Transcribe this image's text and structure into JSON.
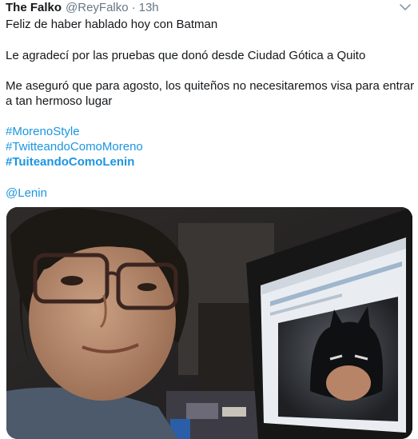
{
  "tweet": {
    "display_name": "The Falko",
    "handle": "@ReyFalko",
    "separator": "·",
    "time": "13h",
    "lines": {
      "l1": "Feliz de haber hablado hoy con Batman",
      "l2": "Le agradecí por las pruebas que donó desde Ciudad Gótica a Quito",
      "l3": "Me aseguró que para agosto, los quiteños no necesitaremos visa para entrar",
      "l4": "a tan hermoso lugar"
    },
    "hashtags": [
      "#MorenoStyle",
      "#TwitteandoComoMoreno",
      "#TuiteandoComoLenin"
    ],
    "mention": "@Lenin",
    "caret_icon": "chevron-down-icon"
  },
  "media": {
    "description_icon": "photo",
    "colors": {
      "background": "#2a2a2e",
      "skin": "#b98a6c",
      "hair": "#1c1814",
      "laptop": "#161616",
      "screen": "#e9edf2"
    }
  },
  "colors": {
    "link": "#1b95e0",
    "text": "#14171a",
    "muted": "#657786"
  }
}
